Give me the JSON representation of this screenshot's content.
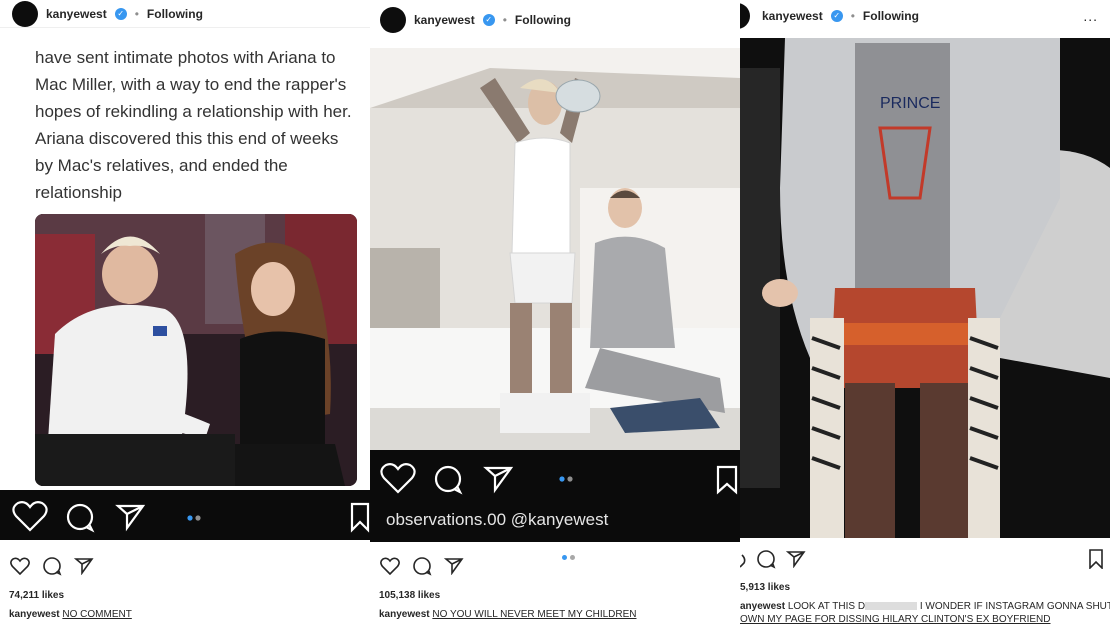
{
  "posts": [
    {
      "username": "kanyewest",
      "following": "Following",
      "tweet_lines": [
        "have sent intimate photos with Ariana to",
        "Mac Miller, with a way to end the rapper's",
        "hopes of rekindling a relationship with her.",
        "Ariana discovered this this end of weeks",
        "by Mac's relatives, and ended the",
        "relationship"
      ],
      "likes": "74,211 likes",
      "caption_user": "kanyewest",
      "caption_text": "NO COMMENT",
      "icons": [
        "heart-icon",
        "comment-icon",
        "share-icon",
        "bookmark-icon"
      ]
    },
    {
      "username": "kanyewest",
      "following": "Following",
      "overlay_text": "observations.00 @kanyewest",
      "likes": "105,138 likes",
      "caption_user": "kanyewest",
      "caption_text": "NO YOU WILL NEVER MEET MY CHILDREN",
      "icons": [
        "heart-icon",
        "comment-icon",
        "share-icon",
        "bookmark-icon"
      ]
    },
    {
      "username": "kanyewest",
      "following": "Following",
      "more": "...",
      "likes": "5,913 likes",
      "caption_user": "anyewest",
      "caption_line1": "LOOK AT THIS D",
      "caption_line1b": "I WONDER IF INSTAGRAM GONNA SHUT",
      "caption_line2": "OWN MY PAGE FOR DISSING HILARY CLINTON'S EX BOYFRIEND",
      "icons": [
        "comment-icon",
        "share-icon",
        "bookmark-icon"
      ]
    }
  ],
  "colors": {
    "instagram_blue": "#3897f0",
    "text": "#262626",
    "dark_bar": "#0b0b0b"
  }
}
